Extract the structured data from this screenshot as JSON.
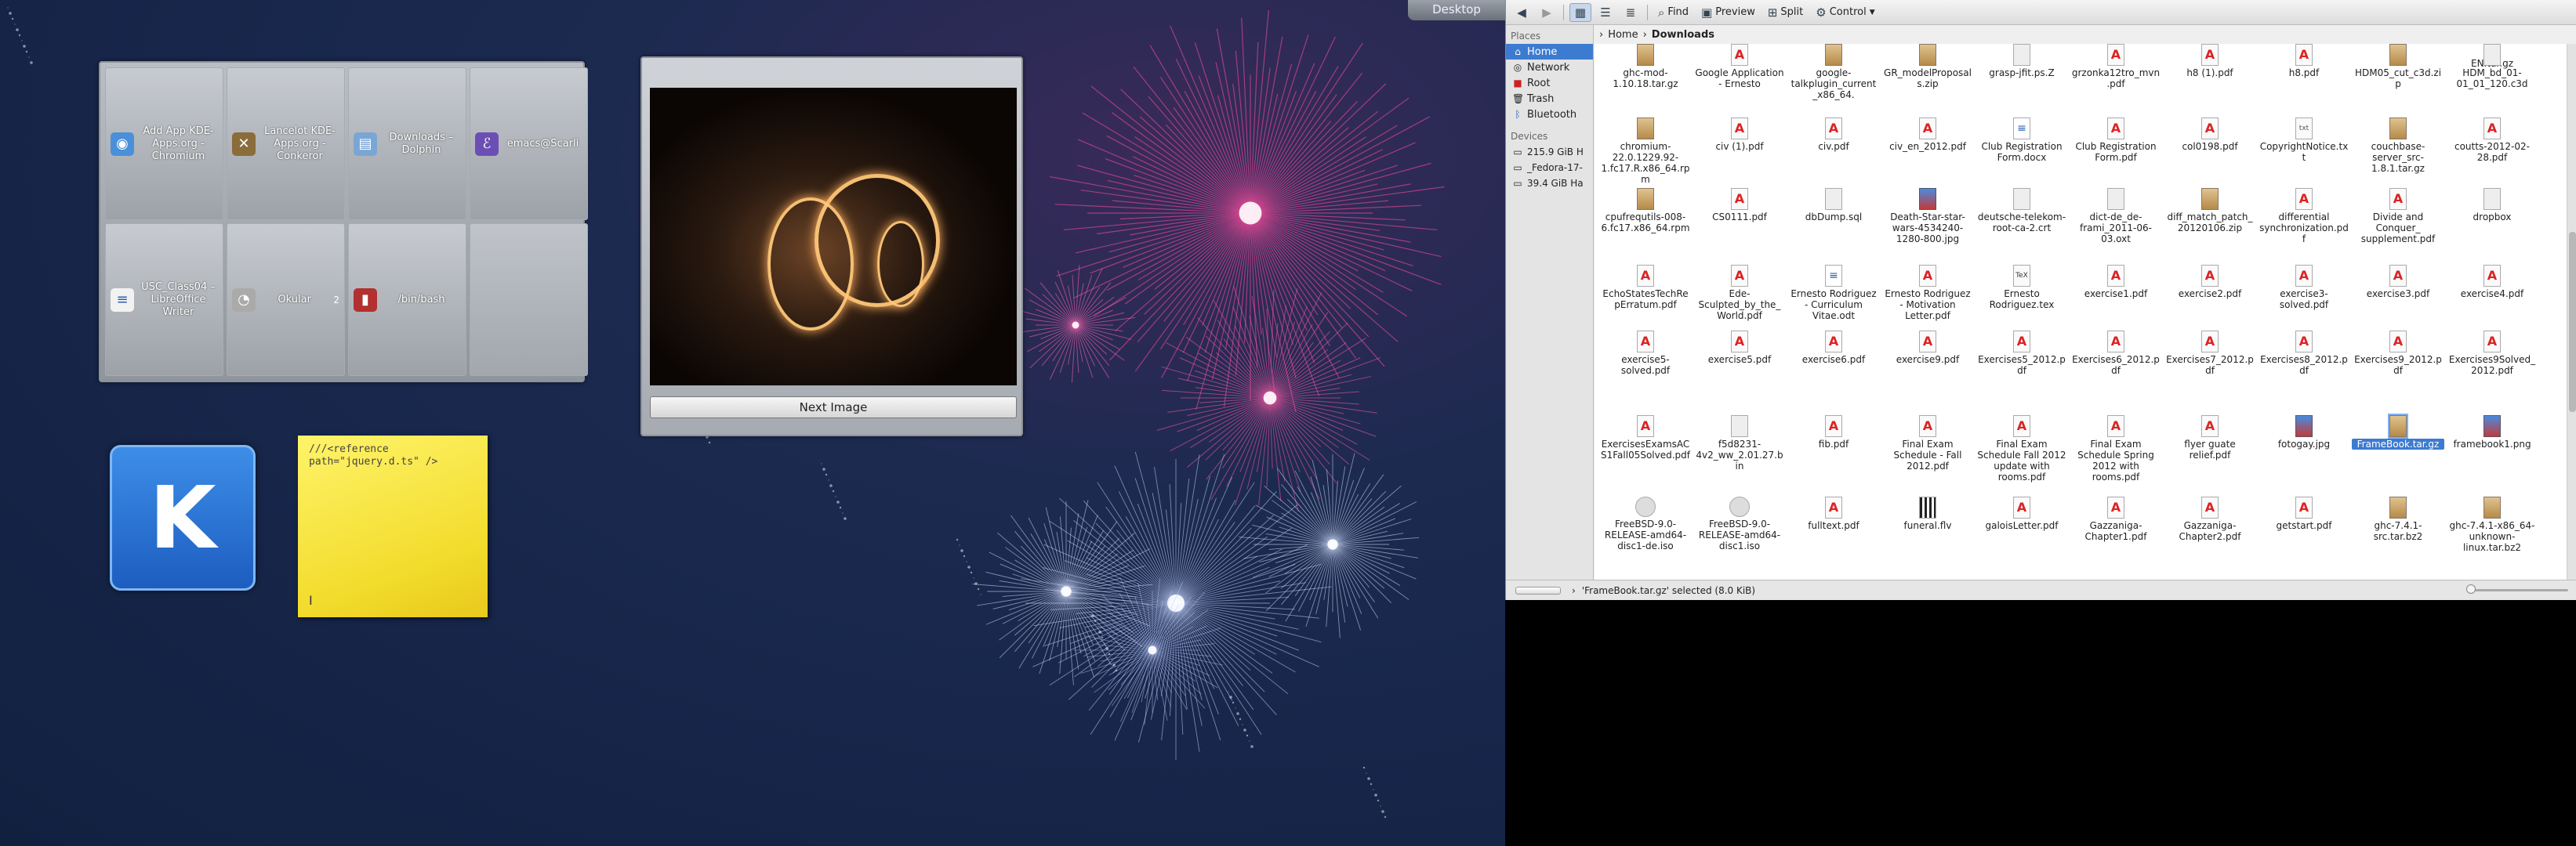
{
  "desktop": {
    "tab_label": "Desktop",
    "quicklaunch": [
      {
        "label": "Add  App KDE-Apps.org - Chromium",
        "icon": "chromium-icon",
        "color": "#4a90d9"
      },
      {
        "label": "Lancelot KDE-Apps.org - Conkeror",
        "icon": "conkeror-icon",
        "color": "#8a6d3b"
      },
      {
        "label": "Downloads – Dolphin",
        "icon": "dolphin-icon",
        "color": "#7aa6d6"
      },
      {
        "label": "emacs@Scarli",
        "icon": "emacs-icon",
        "color": "#6b4fb5"
      },
      {
        "label": "USC_Class04 – LibreOffice Writer",
        "icon": "writer-icon",
        "color": "#f2f2f2"
      },
      {
        "label": "Okular",
        "icon": "okular-icon",
        "color": "#aaaaaa"
      },
      {
        "label": "/bin/bash",
        "icon": "terminal-icon",
        "color": "#b33030"
      },
      {
        "label": "",
        "icon": "",
        "color": ""
      }
    ],
    "ql_badge": "2",
    "slideshow": {
      "button": "Next Image"
    },
    "kde_letter": "K",
    "sticky_note": "///<reference\npath=\"jquery.d.ts\" />",
    "sticky_cursor": "I"
  },
  "dolphin": {
    "toolbar": {
      "find": "Find",
      "preview": "Preview",
      "split": "Split",
      "control": "Control"
    },
    "places": {
      "heading": "Places",
      "items": [
        "Home",
        "Network",
        "Root",
        "Trash",
        "Bluetooth"
      ],
      "devices_heading": "Devices",
      "devices": [
        "215.9 GiB H",
        "_Fedora-17-",
        "39.4 GiB Ha"
      ]
    },
    "breadcrumb": {
      "parent": "Home",
      "current": "Downloads"
    },
    "files": [
      {
        "name": "EN.tar.gz",
        "type": "arc"
      },
      {
        "name": "chromium-22.0.1229.92-1.fc17.R.x86_64.rpm",
        "type": "arc"
      },
      {
        "name": "civ (1).pdf",
        "type": "pdf"
      },
      {
        "name": "civ.pdf",
        "type": "pdf"
      },
      {
        "name": "civ_en_2012.pdf",
        "type": "pdf"
      },
      {
        "name": "Club Registration Form.docx",
        "type": "doc"
      },
      {
        "name": "Club Registration Form.pdf",
        "type": "pdf"
      },
      {
        "name": "col0198.pdf",
        "type": "pdf"
      },
      {
        "name": "CopyrightNotice.txt",
        "type": "txt"
      },
      {
        "name": "couchbase-server_src-1.8.1.tar.gz",
        "type": "arc"
      },
      {
        "name": "coutts-2012-02-28.pdf",
        "type": "pdf"
      },
      {
        "name": "cpufrequtils-008-6.fc17.x86_64.rpm",
        "type": "arc"
      },
      {
        "name": "CS0111.pdf",
        "type": "pdf"
      },
      {
        "name": "dbDump.sql",
        "type": "gen"
      },
      {
        "name": "Death-Star-star-wars-4534240-1280-800.jpg",
        "type": "img"
      },
      {
        "name": "deutsche-telekom-root-ca-2.crt",
        "type": "gen"
      },
      {
        "name": "dict-de_de-frami_2011-06-03.oxt",
        "type": "gen"
      },
      {
        "name": "diff_match_patch_20120106.zip",
        "type": "arc"
      },
      {
        "name": "differential synchronization.pdf",
        "type": "pdf"
      },
      {
        "name": "Divide and Conquer_ supplement.pdf",
        "type": "pdf"
      },
      {
        "name": "dropbox",
        "type": "gen"
      },
      {
        "name": "EchoStatesTechRepErratum.pdf",
        "type": "pdf"
      },
      {
        "name": "Ede-Sculpted_by_the_World.pdf",
        "type": "pdf"
      },
      {
        "name": "Ernesto Rodriguez - Curriculum Vitae.odt",
        "type": "doc"
      },
      {
        "name": "Ernesto Rodriguez - Motivation Letter.pdf",
        "type": "pdf"
      },
      {
        "name": "Ernesto Rodriguez.tex",
        "type": "tex"
      },
      {
        "name": "exercise1.pdf",
        "type": "pdf"
      },
      {
        "name": "exercise2.pdf",
        "type": "pdf"
      },
      {
        "name": "exercise3-solved.pdf",
        "type": "pdf"
      },
      {
        "name": "exercise3.pdf",
        "type": "pdf"
      },
      {
        "name": "exercise4.pdf",
        "type": "pdf"
      },
      {
        "name": "exercise5-solved.pdf",
        "type": "pdf"
      },
      {
        "name": "exercise5.pdf",
        "type": "pdf"
      },
      {
        "name": "exercise6.pdf",
        "type": "pdf"
      },
      {
        "name": "exercise9.pdf",
        "type": "pdf"
      },
      {
        "name": "Exercises5_2012.pdf",
        "type": "pdf"
      },
      {
        "name": "Exercises6_2012.pdf",
        "type": "pdf"
      },
      {
        "name": "Exercises7_2012.pdf",
        "type": "pdf"
      },
      {
        "name": "Exercises8_2012.pdf",
        "type": "pdf"
      },
      {
        "name": "Exercises9_2012.pdf",
        "type": "pdf"
      },
      {
        "name": "Exercises9Solved_2012.pdf",
        "type": "pdf"
      },
      {
        "name": "ExercisesExamsACS1Fall05Solved.pdf",
        "type": "pdf"
      },
      {
        "name": "f5d8231-4v2_ww_2.01.27.bin",
        "type": "gen"
      },
      {
        "name": "fib.pdf",
        "type": "pdf"
      },
      {
        "name": "Final Exam Schedule - Fall 2012.pdf",
        "type": "pdf"
      },
      {
        "name": "Final Exam Schedule Fall 2012 update with rooms.pdf",
        "type": "pdf"
      },
      {
        "name": "Final Exam Schedule Spring 2012 with rooms.pdf",
        "type": "pdf"
      },
      {
        "name": "flyer guate relief.pdf",
        "type": "pdf"
      },
      {
        "name": "fotogay.jpg",
        "type": "img"
      },
      {
        "name": "FrameBook.tar.gz",
        "type": "arc",
        "selected": true
      },
      {
        "name": "framebook1.png",
        "type": "img"
      },
      {
        "name": "FreeBSD-9.0-RELEASE-amd64-disc1-de.iso",
        "type": "dis"
      },
      {
        "name": "FreeBSD-9.0-RELEASE-amd64-disc1.iso",
        "type": "dis"
      },
      {
        "name": "fulltext.pdf",
        "type": "pdf"
      },
      {
        "name": "funeral.flv",
        "type": "mov"
      },
      {
        "name": "galoisLetter.pdf",
        "type": "pdf"
      },
      {
        "name": "Gazzaniga-Chapter1.pdf",
        "type": "pdf"
      },
      {
        "name": "Gazzaniga-Chapter2.pdf",
        "type": "pdf"
      },
      {
        "name": "getstart.pdf",
        "type": "pdf"
      },
      {
        "name": "ghc-7.4.1-src.tar.bz2",
        "type": "arc"
      },
      {
        "name": "ghc-7.4.1-x86_64-unknown-linux.tar.bz2",
        "type": "arc"
      },
      {
        "name": "ghc-mod-1.10.18.tar.gz",
        "type": "arc"
      },
      {
        "name": "Google Application - Ernesto",
        "type": "pdf"
      },
      {
        "name": "google-talkplugin_current_x86_64.",
        "type": "arc"
      },
      {
        "name": "GR_modelProposals.zip",
        "type": "arc"
      },
      {
        "name": "grasp-jfit.ps.Z",
        "type": "gen"
      },
      {
        "name": "grzonka12tro_mvn.pdf",
        "type": "pdf"
      },
      {
        "name": "h8 (1).pdf",
        "type": "pdf"
      },
      {
        "name": "h8.pdf",
        "type": "pdf"
      },
      {
        "name": "HDM05_cut_c3d.zip",
        "type": "arc"
      },
      {
        "name": "HDM_bd_01-01_01_120.c3d",
        "type": "gen"
      }
    ],
    "status": "'FrameBook.tar.gz' selected (8.0 KiB)"
  }
}
